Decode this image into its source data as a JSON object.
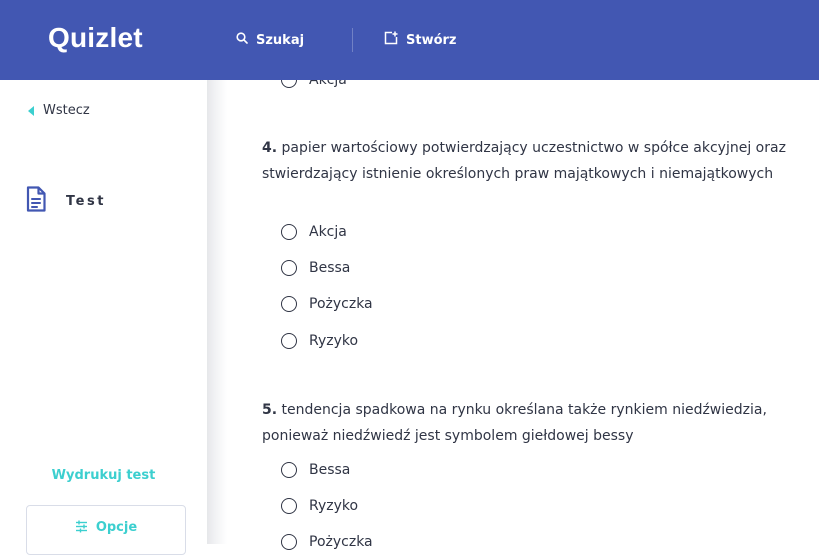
{
  "header": {
    "logo": "Quizlet",
    "search_label": "Szukaj",
    "create_label": "Stwórz"
  },
  "sidebar": {
    "back_label": "Wstecz",
    "mode_label": "Test",
    "print_label": "Wydrukuj test",
    "options_label": "Opcje"
  },
  "questions": [
    {
      "options": [
        "Akcja"
      ]
    },
    {
      "number": "4.",
      "text": "papier wartościowy potwierdzający uczestnictwo w spółce akcyjnej oraz stwierdzający istnienie określonych praw majątkowych i niemajątkowych",
      "options": [
        "Akcja",
        "Bessa",
        "Pożyczka",
        "Ryzyko"
      ]
    },
    {
      "number": "5.",
      "text": "tendencja spadkowa na rynku określana także rynkiem niedźwiedzia, ponieważ niedźwiedź jest symbolem giełdowej bessy",
      "options": [
        "Bessa",
        "Ryzyko",
        "Pożyczka"
      ]
    }
  ]
}
